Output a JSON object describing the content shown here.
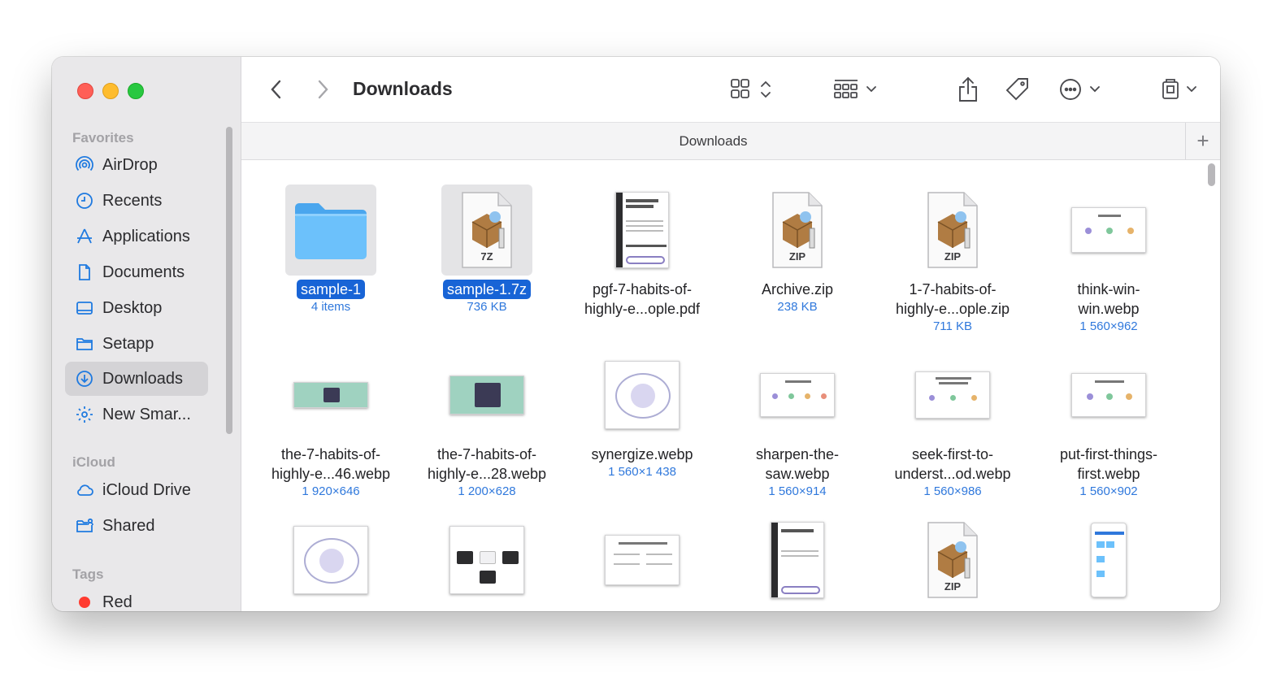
{
  "window": {
    "title": "Downloads",
    "tab_label": "Downloads"
  },
  "sidebar": {
    "favorites_header": "Favorites",
    "favorites": [
      {
        "label": "AirDrop",
        "icon": "airdrop-icon"
      },
      {
        "label": "Recents",
        "icon": "clock-icon"
      },
      {
        "label": "Applications",
        "icon": "applications-icon"
      },
      {
        "label": "Documents",
        "icon": "document-icon"
      },
      {
        "label": "Desktop",
        "icon": "desktop-icon"
      },
      {
        "label": "Setapp",
        "icon": "folder-icon"
      },
      {
        "label": "Downloads",
        "icon": "download-icon",
        "selected": true
      },
      {
        "label": "New Smar...",
        "icon": "gear-icon"
      }
    ],
    "icloud_header": "iCloud",
    "icloud": [
      {
        "label": "iCloud Drive",
        "icon": "cloud-icon"
      },
      {
        "label": "Shared",
        "icon": "shared-folder-icon"
      }
    ],
    "tags_header": "Tags",
    "tags": [
      {
        "label": "Red",
        "color": "#ff3b30"
      }
    ]
  },
  "files": [
    {
      "name": "sample-1",
      "meta": "4 items",
      "kind": "folder",
      "selected": true
    },
    {
      "name": "sample-1.7z",
      "meta": "736 KB",
      "kind": "archive",
      "badge": "7Z",
      "selected": true
    },
    {
      "name_line1": "pgf-7-habits-of-",
      "name_line2": "highly-e...ople.pdf",
      "kind": "pdf"
    },
    {
      "name": "Archive.zip",
      "meta": "238 KB",
      "kind": "archive",
      "badge": "ZIP"
    },
    {
      "name_line1": "1-7-habits-of-",
      "name_line2": "highly-e...ople.zip",
      "meta": "711 KB",
      "kind": "archive",
      "badge": "ZIP"
    },
    {
      "name_line1": "think-win-",
      "name_line2": "win.webp",
      "meta": "1 560×962",
      "kind": "image"
    },
    {
      "name_line1": "the-7-habits-of-",
      "name_line2": "highly-e...46.webp",
      "meta": "1 920×646",
      "kind": "banner"
    },
    {
      "name_line1": "the-7-habits-of-",
      "name_line2": "highly-e...28.webp",
      "meta": "1 200×628",
      "kind": "banner"
    },
    {
      "name": "synergize.webp",
      "meta": "1 560×1 438",
      "kind": "cycle"
    },
    {
      "name_line1": "sharpen-the-",
      "name_line2": "saw.webp",
      "meta": "1 560×914",
      "kind": "image"
    },
    {
      "name_line1": "seek-first-to-",
      "name_line2": "underst...od.webp",
      "meta": "1 560×986",
      "kind": "image"
    },
    {
      "name_line1": "put-first-things-",
      "name_line2": "first.webp",
      "meta": "1 560×902",
      "kind": "image"
    }
  ],
  "toolbar": {
    "back": "chevron-left-icon",
    "forward": "chevron-right-icon",
    "view": "grid-view-icon",
    "group": "group-icon",
    "share": "share-icon",
    "tag": "tag-icon",
    "more": "ellipsis-icon",
    "eject": "device-icon",
    "search": "search-icon"
  }
}
